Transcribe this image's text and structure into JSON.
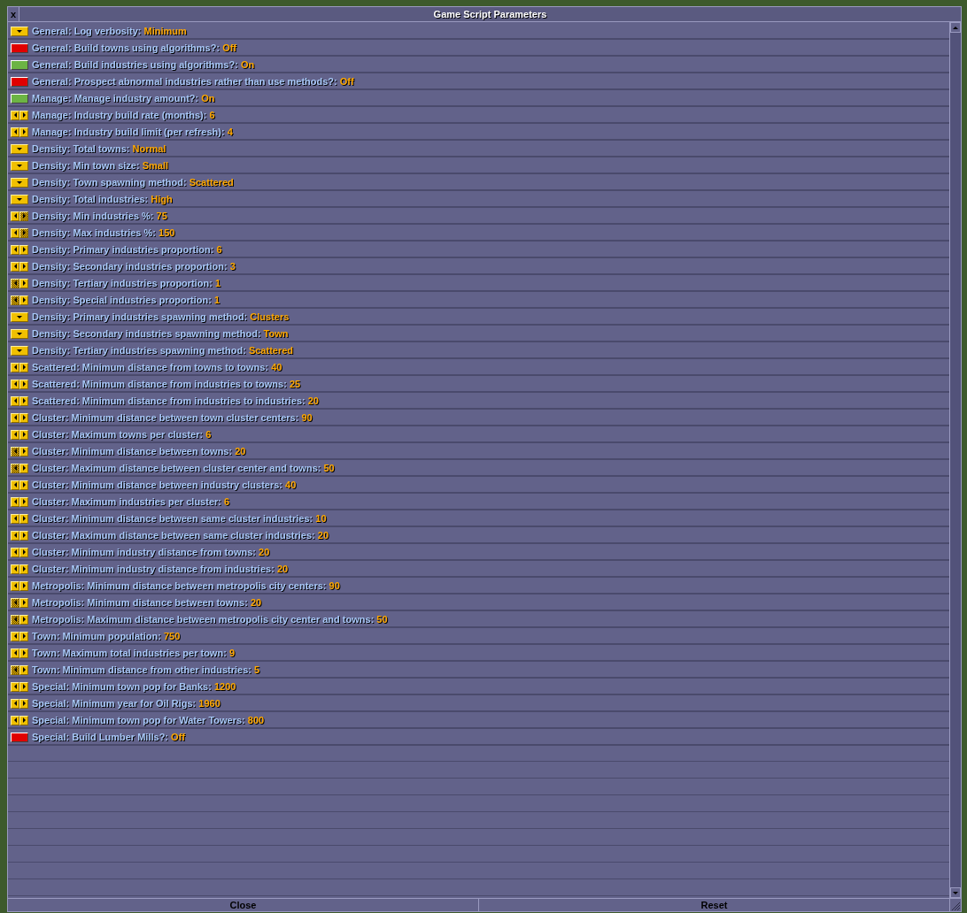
{
  "window": {
    "title": "Game Script Parameters",
    "close_glyph": "x"
  },
  "settings": [
    {
      "kind": "dropdown",
      "label": "General: Log verbosity:",
      "value": "Minimum"
    },
    {
      "kind": "toggle",
      "on": false,
      "label": "General: Build towns using algorithms?:",
      "value": "Off"
    },
    {
      "kind": "toggle",
      "on": true,
      "label": "General: Build industries using algorithms?:",
      "value": "On"
    },
    {
      "kind": "toggle",
      "on": false,
      "label": "General: Prospect abnormal industries rather than use methods?:",
      "value": "Off"
    },
    {
      "kind": "toggle",
      "on": true,
      "label": "Manage: Manage industry amount?:",
      "value": "On"
    },
    {
      "kind": "stepper",
      "decrease_disabled": false,
      "increase_disabled": false,
      "label": "Manage: Industry build rate (months):",
      "value": "6"
    },
    {
      "kind": "stepper",
      "decrease_disabled": false,
      "increase_disabled": false,
      "label": "Manage: Industry build limit (per refresh):",
      "value": "4"
    },
    {
      "kind": "dropdown",
      "label": "Density: Total towns:",
      "value": "Normal"
    },
    {
      "kind": "dropdown",
      "label": "Density: Min town size:",
      "value": "Small"
    },
    {
      "kind": "dropdown",
      "label": "Density: Town spawning method:",
      "value": "Scattered"
    },
    {
      "kind": "dropdown",
      "label": "Density: Total industries:",
      "value": "High"
    },
    {
      "kind": "stepper",
      "decrease_disabled": false,
      "increase_disabled": true,
      "label": "Density: Min industries %:",
      "value": "75"
    },
    {
      "kind": "stepper",
      "decrease_disabled": false,
      "increase_disabled": true,
      "label": "Density: Max industries %:",
      "value": "150"
    },
    {
      "kind": "stepper",
      "decrease_disabled": false,
      "increase_disabled": false,
      "label": "Density: Primary industries proportion:",
      "value": "6"
    },
    {
      "kind": "stepper",
      "decrease_disabled": false,
      "increase_disabled": false,
      "label": "Density: Secondary industries proportion:",
      "value": "3"
    },
    {
      "kind": "stepper",
      "decrease_disabled": true,
      "increase_disabled": false,
      "label": "Density: Tertiary industries proportion:",
      "value": "1"
    },
    {
      "kind": "stepper",
      "decrease_disabled": true,
      "increase_disabled": false,
      "label": "Density: Special industries proportion:",
      "value": "1"
    },
    {
      "kind": "dropdown",
      "label": "Density: Primary industries spawning method:",
      "value": "Clusters"
    },
    {
      "kind": "dropdown",
      "label": "Density: Secondary industries spawning method:",
      "value": "Town"
    },
    {
      "kind": "dropdown",
      "label": "Density: Tertiary industries spawning method:",
      "value": "Scattered"
    },
    {
      "kind": "stepper",
      "decrease_disabled": false,
      "increase_disabled": false,
      "label": "Scattered: Minimum distance from towns to towns:",
      "value": "40"
    },
    {
      "kind": "stepper",
      "decrease_disabled": false,
      "increase_disabled": false,
      "label": "Scattered: Minimum distance from industries to towns:",
      "value": "25"
    },
    {
      "kind": "stepper",
      "decrease_disabled": false,
      "increase_disabled": false,
      "label": "Scattered: Minimum distance from industries to industries:",
      "value": "20"
    },
    {
      "kind": "stepper",
      "decrease_disabled": false,
      "increase_disabled": false,
      "label": "Cluster: Minimum distance between town cluster centers:",
      "value": "90"
    },
    {
      "kind": "stepper",
      "decrease_disabled": false,
      "increase_disabled": false,
      "label": "Cluster: Maximum towns per cluster:",
      "value": "6"
    },
    {
      "kind": "stepper",
      "decrease_disabled": true,
      "increase_disabled": false,
      "label": "Cluster: Minimum distance between towns:",
      "value": "20"
    },
    {
      "kind": "stepper",
      "decrease_disabled": true,
      "increase_disabled": false,
      "label": "Cluster: Maximum distance between cluster center and towns:",
      "value": "50"
    },
    {
      "kind": "stepper",
      "decrease_disabled": false,
      "increase_disabled": false,
      "label": "Cluster: Minimum distance between industry clusters:",
      "value": "40"
    },
    {
      "kind": "stepper",
      "decrease_disabled": false,
      "increase_disabled": false,
      "label": "Cluster: Maximum industries per cluster:",
      "value": "6"
    },
    {
      "kind": "stepper",
      "decrease_disabled": false,
      "increase_disabled": false,
      "label": "Cluster: Minimum distance between same cluster industries:",
      "value": "10"
    },
    {
      "kind": "stepper",
      "decrease_disabled": false,
      "increase_disabled": false,
      "label": "Cluster: Maximum distance between same cluster industries:",
      "value": "20"
    },
    {
      "kind": "stepper",
      "decrease_disabled": false,
      "increase_disabled": false,
      "label": "Cluster: Minimum industry distance from towns:",
      "value": "20"
    },
    {
      "kind": "stepper",
      "decrease_disabled": false,
      "increase_disabled": false,
      "label": "Cluster: Minimum industry distance from industries:",
      "value": "20"
    },
    {
      "kind": "stepper",
      "decrease_disabled": false,
      "increase_disabled": false,
      "label": "Metropolis: Minimum distance between metropolis city centers:",
      "value": "90"
    },
    {
      "kind": "stepper",
      "decrease_disabled": true,
      "increase_disabled": false,
      "label": "Metropolis: Minimum distance between towns:",
      "value": "20"
    },
    {
      "kind": "stepper",
      "decrease_disabled": true,
      "increase_disabled": false,
      "label": "Metropolis: Maximum distance between metropolis city center and towns:",
      "value": "50"
    },
    {
      "kind": "stepper",
      "decrease_disabled": false,
      "increase_disabled": false,
      "label": "Town: Minimum population:",
      "value": "750"
    },
    {
      "kind": "stepper",
      "decrease_disabled": false,
      "increase_disabled": false,
      "label": "Town: Maximum total industries per town:",
      "value": "9"
    },
    {
      "kind": "stepper",
      "decrease_disabled": true,
      "increase_disabled": false,
      "label": "Town: Minimum distance from other industries:",
      "value": "5"
    },
    {
      "kind": "stepper",
      "decrease_disabled": false,
      "increase_disabled": false,
      "label": "Special: Minimum town pop for Banks:",
      "value": "1200"
    },
    {
      "kind": "stepper",
      "decrease_disabled": false,
      "increase_disabled": false,
      "label": "Special: Minimum year for Oil Rigs:",
      "value": "1960"
    },
    {
      "kind": "stepper",
      "decrease_disabled": false,
      "increase_disabled": false,
      "label": "Special: Minimum town pop for Water Towers:",
      "value": "800"
    },
    {
      "kind": "toggle",
      "on": false,
      "label": "Special: Build Lumber Mills?:",
      "value": "Off"
    }
  ],
  "buttons": [
    "Close",
    "Reset"
  ]
}
